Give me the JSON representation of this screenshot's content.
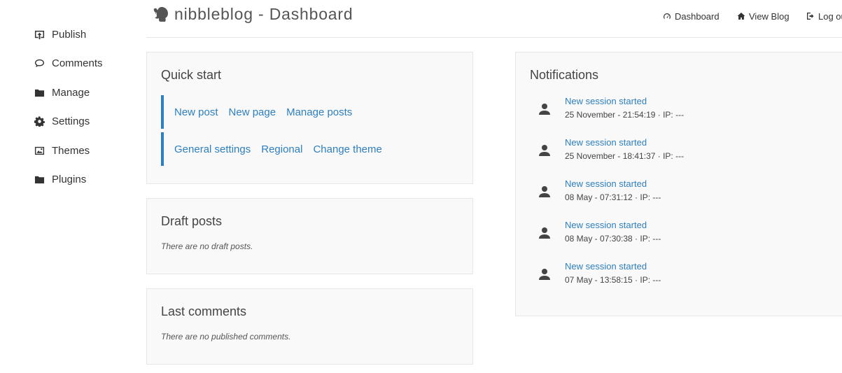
{
  "header": {
    "title": "nibbleblog - Dashboard",
    "nav": [
      {
        "label": "Dashboard",
        "icon": "gauge-icon"
      },
      {
        "label": "View Blog",
        "icon": "home-icon"
      },
      {
        "label": "Log ou",
        "icon": "logout-icon"
      }
    ]
  },
  "sidebar": {
    "items": [
      {
        "label": "Publish",
        "icon": "publish-icon"
      },
      {
        "label": "Comments",
        "icon": "comment-icon"
      },
      {
        "label": "Manage",
        "icon": "folder-icon"
      },
      {
        "label": "Settings",
        "icon": "gear-icon"
      },
      {
        "label": "Themes",
        "icon": "image-icon"
      },
      {
        "label": "Plugins",
        "icon": "folder-icon"
      }
    ]
  },
  "quick_start": {
    "title": "Quick start",
    "row1": [
      "New post",
      "New page",
      "Manage posts"
    ],
    "row2": [
      "General settings",
      "Regional",
      "Change theme"
    ]
  },
  "draft_posts": {
    "title": "Draft posts",
    "empty": "There are no draft posts."
  },
  "last_comments": {
    "title": "Last comments",
    "empty": "There are no published comments."
  },
  "notifications": {
    "title": "Notifications",
    "items": [
      {
        "title": "New session started",
        "meta": "25 November - 21:54:19 · IP: ---"
      },
      {
        "title": "New session started",
        "meta": "25 November - 18:41:37 · IP: ---"
      },
      {
        "title": "New session started",
        "meta": "08 May - 07:31:12 · IP: ---"
      },
      {
        "title": "New session started",
        "meta": "08 May - 07:30:38 · IP: ---"
      },
      {
        "title": "New session started",
        "meta": "07 May - 13:58:15 · IP: ---"
      }
    ]
  },
  "colors": {
    "link": "#2d7fc0",
    "panel_bg": "#f9f9f9",
    "panel_border": "#e7e7e7"
  }
}
